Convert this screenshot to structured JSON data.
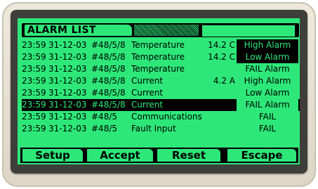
{
  "screen": {
    "title": "ALARM LIST"
  },
  "alarms": [
    {
      "time": "23:59",
      "date": "31-12-03",
      "device": "#48/5/8",
      "description": "Temperature",
      "value": "14.2 C",
      "status": "High Alarm"
    },
    {
      "time": "23:59",
      "date": "31-12-03",
      "device": "#48/5/8",
      "description": "Temperature",
      "value": "14.2 C",
      "status": "Low Alarm"
    },
    {
      "time": "23:59",
      "date": "31-12-03",
      "device": "#48/5/8",
      "description": "Temperature",
      "value": "",
      "status": "FAIL Alarm"
    },
    {
      "time": "23:59",
      "date": "31-12-03",
      "device": "#48/5/8",
      "description": "Current",
      "value": "4.2 A",
      "status": "High Alarm"
    },
    {
      "time": "23:59",
      "date": "31-12-03",
      "device": "#48/5/8",
      "description": "Current",
      "value": "",
      "status": "Low Alarm"
    },
    {
      "time": "23:59",
      "date": "31-12-03",
      "device": "#48/5/8",
      "description": "Current",
      "value": "",
      "status": "FAIL Alarm"
    },
    {
      "time": "23:59",
      "date": "31-12-03",
      "device": "#48/5",
      "description": "Communications",
      "value": "",
      "status": "FAIL"
    },
    {
      "time": "23:59",
      "date": "31-12-03",
      "device": "#48/5",
      "description": "Fault Input",
      "value": "",
      "status": "FAIL"
    }
  ],
  "function_keys": {
    "setup": "Setup",
    "accept": "Accept",
    "reset": "Reset",
    "escape": "Escape"
  },
  "colors": {
    "lcd_green": "#2de879",
    "ink": "#000000",
    "bezel": "#e6e0d2"
  }
}
